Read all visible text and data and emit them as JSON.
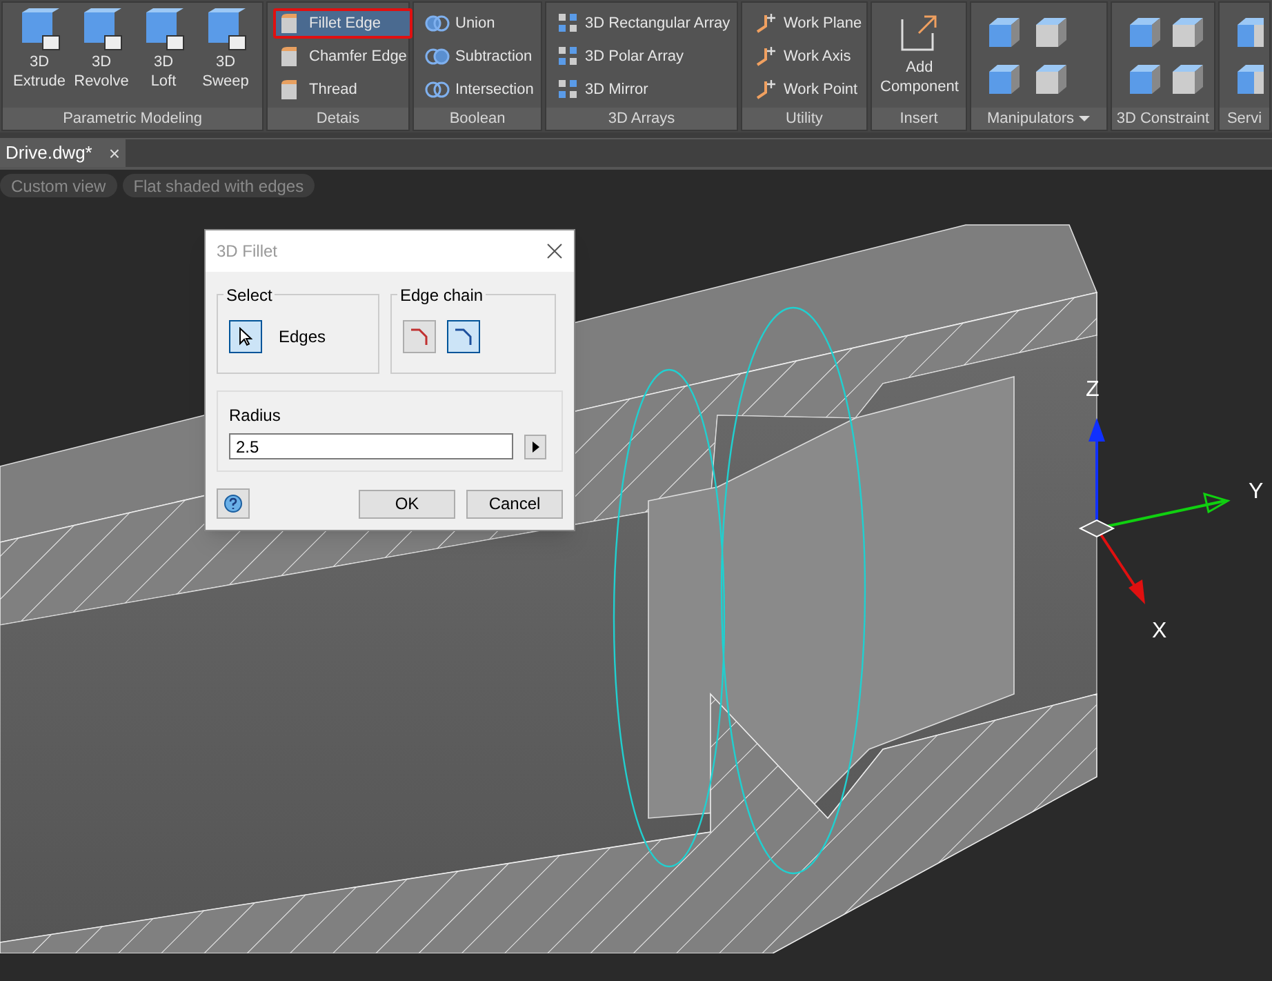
{
  "ribbon": {
    "panels": [
      {
        "title": "Parametric Modeling",
        "kind": "large",
        "items": [
          {
            "label": "3D\nExtrude",
            "selected": false
          },
          {
            "label": "3D\nRevolve",
            "selected": false
          },
          {
            "label": "3D\nLoft",
            "selected": false
          },
          {
            "label": "3D\nSweep",
            "selected": false
          }
        ]
      },
      {
        "title": "Detais",
        "kind": "small",
        "items": [
          {
            "label": "Fillet Edge",
            "selected": true
          },
          {
            "label": "Chamfer Edge",
            "selected": false
          },
          {
            "label": "Thread",
            "selected": false
          }
        ]
      },
      {
        "title": "Boolean",
        "kind": "small",
        "items": [
          {
            "label": "Union",
            "selected": false
          },
          {
            "label": "Subtraction",
            "selected": false
          },
          {
            "label": "Intersection",
            "selected": false
          }
        ]
      },
      {
        "title": "3D Arrays",
        "kind": "small",
        "items": [
          {
            "label": "3D Rectangular Array",
            "selected": false
          },
          {
            "label": "3D Polar Array",
            "selected": false
          },
          {
            "label": "3D Mirror",
            "selected": false
          }
        ]
      },
      {
        "title": "Utility",
        "kind": "small",
        "items": [
          {
            "label": "Work Plane",
            "selected": false
          },
          {
            "label": "Work Axis",
            "selected": false
          },
          {
            "label": "Work Point",
            "selected": false
          }
        ]
      },
      {
        "title": "Insert",
        "kind": "large",
        "items": [
          {
            "label": "Add\nComponent",
            "selected": false
          }
        ]
      },
      {
        "title": "Manipulators",
        "kind": "icons",
        "dropdown": true
      },
      {
        "title": "3D Constraint",
        "kind": "icons",
        "dropdown": false
      },
      {
        "title": "Servi",
        "kind": "icons",
        "dropdown": false
      }
    ]
  },
  "document_tab": {
    "title": "Drive.dwg*",
    "close": "×"
  },
  "view_controls": [
    "Custom view",
    "Flat shaded with edges"
  ],
  "viewport": {
    "axes": [
      "Z",
      "Y",
      "X"
    ]
  },
  "dialog": {
    "title": "3D Fillet",
    "select_group": {
      "title": "Select",
      "button_selected": true,
      "label": "Edges"
    },
    "edge_chain_group": {
      "title": "Edge chain",
      "buttons": [
        {
          "selected": false
        },
        {
          "selected": true
        }
      ]
    },
    "radius": {
      "label": "Radius",
      "value": "2.5"
    },
    "buttons": [
      "OK",
      "Cancel"
    ]
  }
}
